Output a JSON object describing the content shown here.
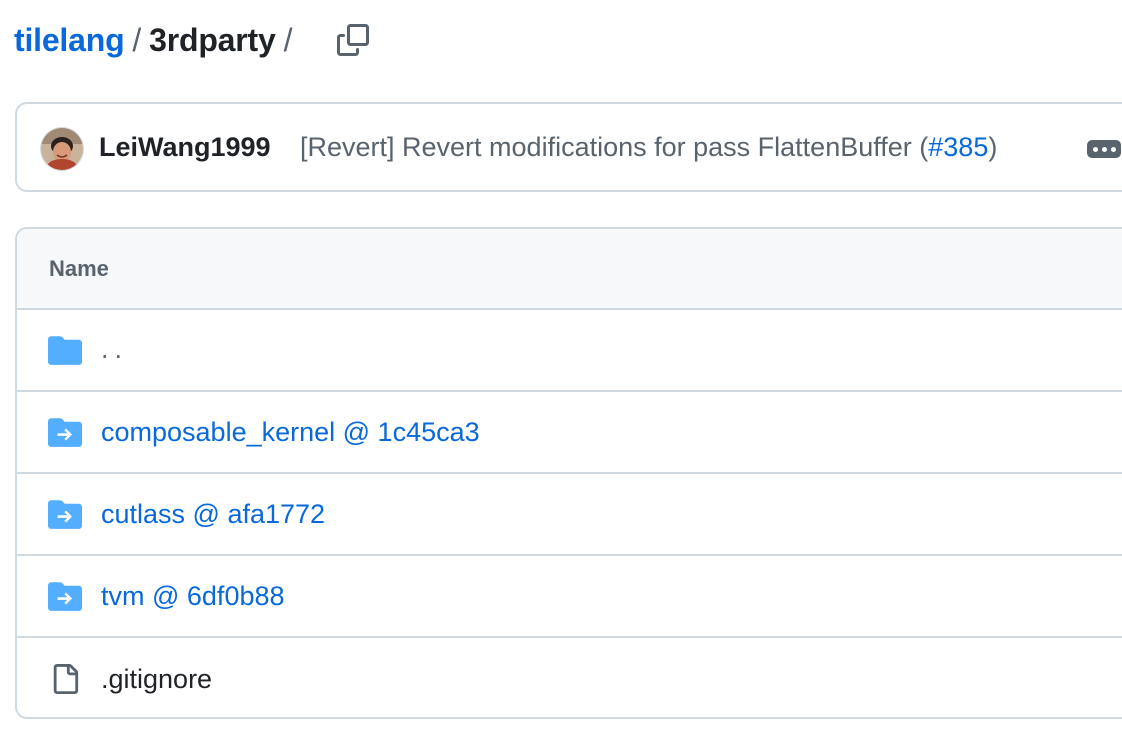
{
  "breadcrumb": {
    "repo": "tilelang",
    "separator": "/",
    "current": "3rdparty",
    "trailing_separator": "/"
  },
  "commit": {
    "author": "LeiWang1999",
    "message_prefix": "[Revert] Revert modifications for pass FlattenBuffer (",
    "pr_number": "#385",
    "message_suffix": ")"
  },
  "table": {
    "header": "Name",
    "rows": [
      {
        "name": "..",
        "icon": "folder-icon",
        "type": "parent"
      },
      {
        "name": "composable_kernel @ 1c45ca3",
        "icon": "submodule-icon",
        "type": "submodule"
      },
      {
        "name": "cutlass @ afa1772",
        "icon": "submodule-icon",
        "type": "submodule"
      },
      {
        "name": "tvm @ 6df0b88",
        "icon": "submodule-icon",
        "type": "submodule"
      },
      {
        "name": ".gitignore",
        "icon": "file-icon",
        "type": "file"
      }
    ]
  },
  "colors": {
    "link": "#0969da",
    "folder": "#54aeff",
    "muted": "#59636e",
    "border": "#d1d9e0"
  }
}
